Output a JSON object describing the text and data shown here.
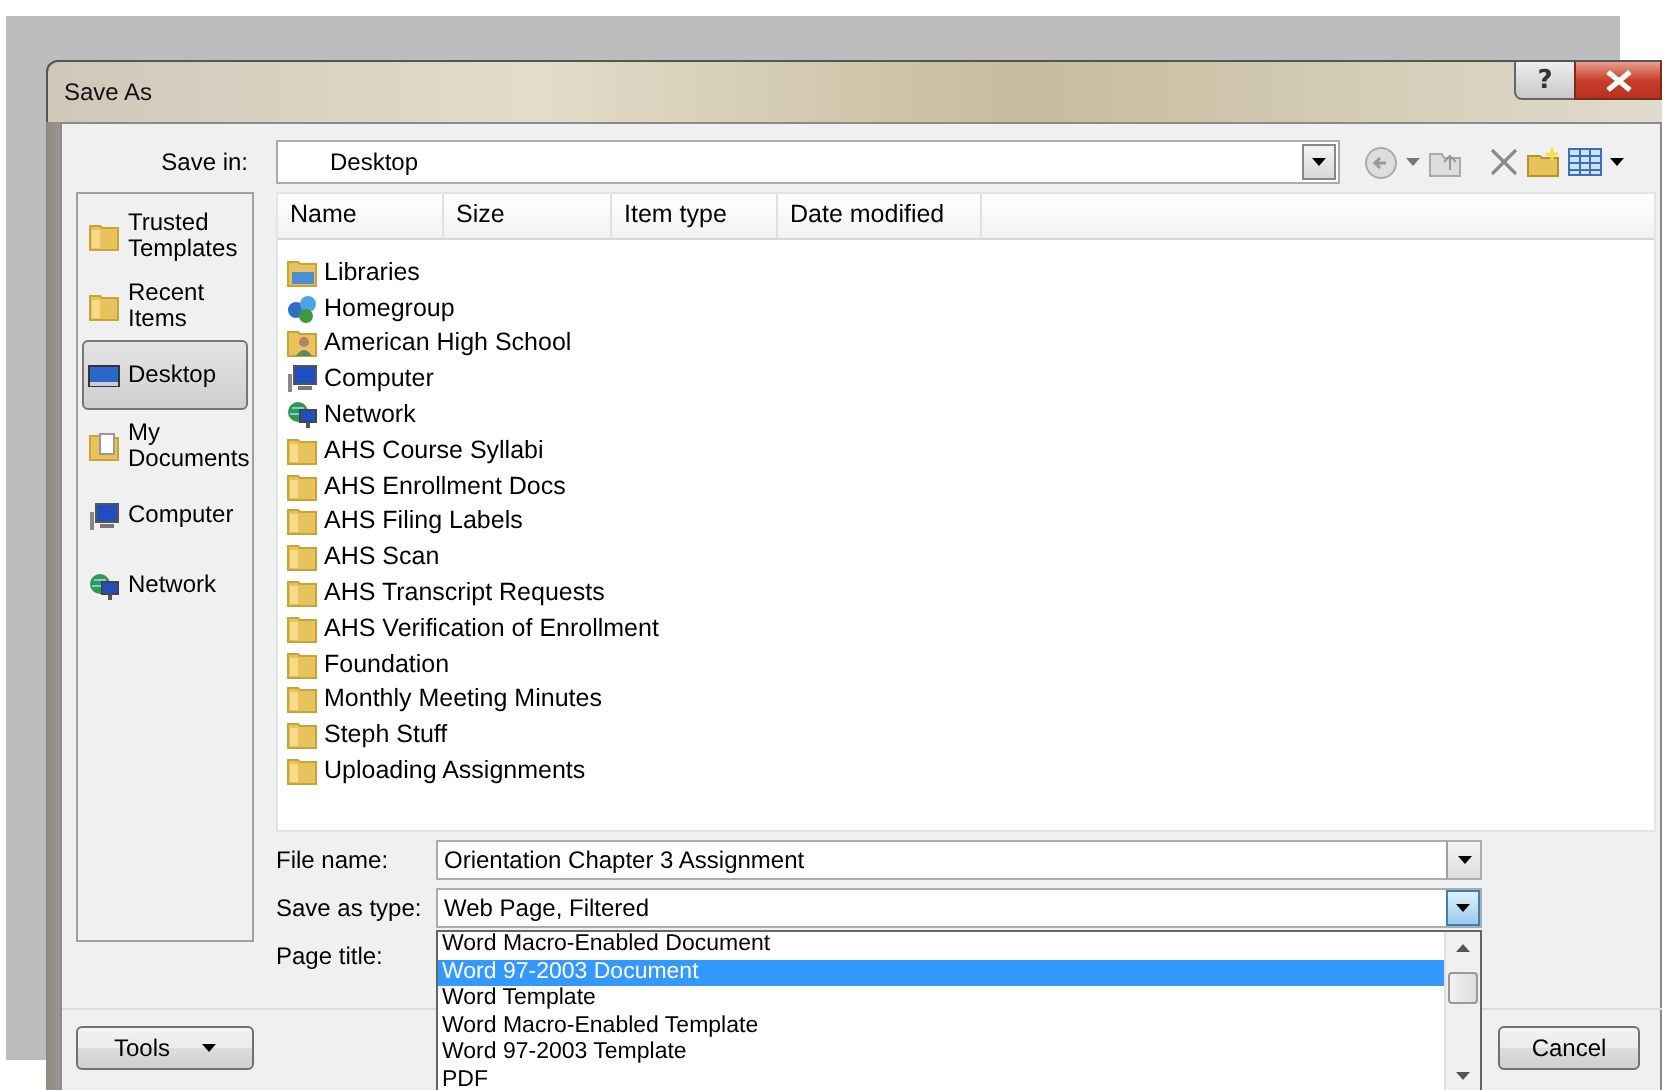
{
  "window": {
    "title": "Save As",
    "help_button": "?"
  },
  "save_in": {
    "label": "Save in:",
    "value": "Desktop"
  },
  "places": [
    {
      "label": "Trusted Templates",
      "kind": "folder",
      "selected": false
    },
    {
      "label": "Recent Items",
      "kind": "folder",
      "selected": false
    },
    {
      "label": "Desktop",
      "kind": "desktop",
      "selected": true
    },
    {
      "label": "My Documents",
      "kind": "documents",
      "selected": false
    },
    {
      "label": "Computer",
      "kind": "computer",
      "selected": false
    },
    {
      "label": "Network",
      "kind": "network",
      "selected": false
    }
  ],
  "file_list": {
    "columns": [
      "Name",
      "Size",
      "Item type",
      "Date modified"
    ],
    "items": [
      {
        "name": "Libraries",
        "kind": "library"
      },
      {
        "name": "Homegroup",
        "kind": "homegroup"
      },
      {
        "name": "American High School",
        "kind": "user"
      },
      {
        "name": "Computer",
        "kind": "computer"
      },
      {
        "name": "Network",
        "kind": "network"
      },
      {
        "name": "AHS Course Syllabi",
        "kind": "folder"
      },
      {
        "name": "AHS Enrollment Docs",
        "kind": "folder"
      },
      {
        "name": "AHS Filing Labels",
        "kind": "folder"
      },
      {
        "name": "AHS Scan",
        "kind": "folder"
      },
      {
        "name": "AHS Transcript Requests",
        "kind": "folder"
      },
      {
        "name": "AHS Verification of Enrollment",
        "kind": "folder"
      },
      {
        "name": "Foundation",
        "kind": "folder"
      },
      {
        "name": "Monthly Meeting Minutes",
        "kind": "folder"
      },
      {
        "name": "Steph Stuff",
        "kind": "folder"
      },
      {
        "name": "Uploading Assignments",
        "kind": "folder"
      }
    ]
  },
  "fields": [
    {
      "label": "File name:",
      "value": "Orientation Chapter 3 Assignment",
      "open": false
    },
    {
      "label": "Save as type:",
      "value": "Web Page, Filtered",
      "open": true
    },
    {
      "label": "Page title:"
    }
  ],
  "type_options": [
    {
      "label": "Word Macro-Enabled Document",
      "selected": false
    },
    {
      "label": "Word 97-2003 Document",
      "selected": true
    },
    {
      "label": "Word Template",
      "selected": false
    },
    {
      "label": "Word Macro-Enabled Template",
      "selected": false
    },
    {
      "label": "Word 97-2003 Template",
      "selected": false
    },
    {
      "label": "PDF",
      "selected": false
    }
  ],
  "buttons": {
    "tools": "Tools",
    "cancel": "Cancel"
  }
}
